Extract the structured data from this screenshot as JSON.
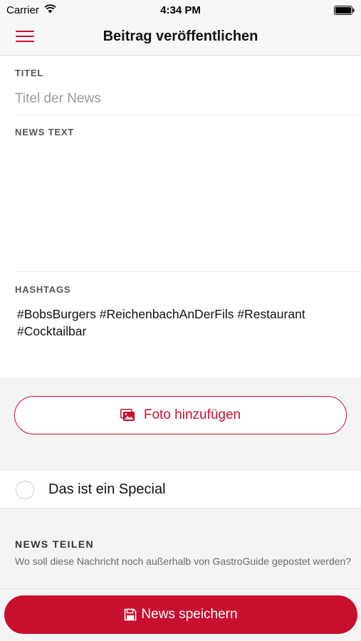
{
  "status_bar": {
    "carrier": "Carrier",
    "time": "4:34 PM"
  },
  "nav": {
    "title": "Beitrag veröffentlichen",
    "menu_icon": "hamburger-menu-icon"
  },
  "form": {
    "title_label": "TITEL",
    "title_placeholder": "Titel der News",
    "news_text_label": "NEWS TEXT",
    "hashtags_label": "HASHTAGS",
    "hashtags_value": "#BobsBurgers #ReichenbachAnDerFils #Restaurant #Cocktailbar"
  },
  "photo_button": {
    "label": "Foto hinzufügen",
    "icon": "photo-gallery-icon"
  },
  "special": {
    "label": "Das ist ein Special",
    "checked": false
  },
  "share": {
    "label": "NEWS TEILEN",
    "description": "Wo soll diese Nachricht noch außerhalb von GastroGuide gepostet werden?"
  },
  "save_button": {
    "label": "News speichern",
    "icon": "floppy-disk-icon"
  },
  "colors": {
    "accent": "#c8102e",
    "background": "#f4f4f4",
    "card": "#ffffff"
  }
}
